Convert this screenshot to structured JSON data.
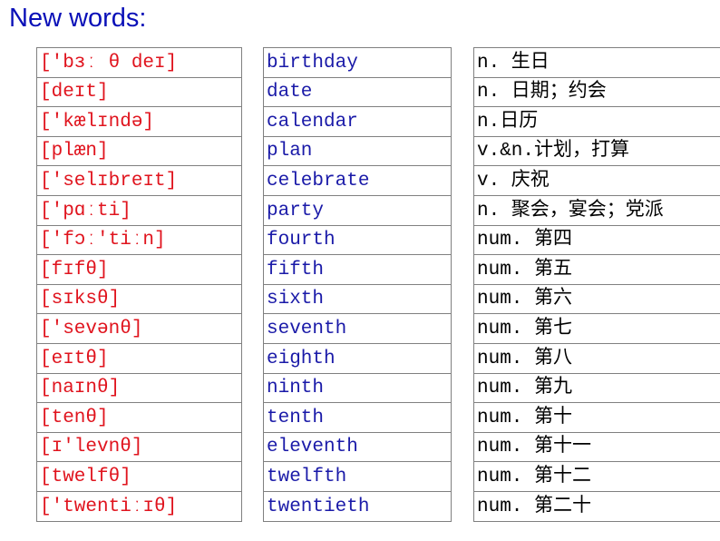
{
  "title": "New words:",
  "colors": {
    "title": "#0a10b8",
    "phonetic": "#e0141e",
    "word": "#1a1aa8",
    "meaning": "#000000"
  },
  "rows": [
    {
      "phonetic": "['bɜː θ deɪ]",
      "word": "birthday",
      "meaning": "n. 生日"
    },
    {
      "phonetic": "[deɪt]",
      "word": "date",
      "meaning": "n. 日期；约会"
    },
    {
      "phonetic": "['kælɪndə]",
      "word": "calendar",
      "meaning": "n.日历"
    },
    {
      "phonetic": "[plæn]",
      "word": "plan",
      "meaning": "v.&n.计划，打算"
    },
    {
      "phonetic": "['selɪbreɪt]",
      "word": "celebrate",
      "meaning": "v. 庆祝"
    },
    {
      "phonetic": "['pɑːti]",
      "word": "party",
      "meaning": "n. 聚会，宴会；党派"
    },
    {
      "phonetic": "['fɔː'tiːn]",
      "word": "fourth",
      "meaning": "num. 第四"
    },
    {
      "phonetic": "[fɪfθ]",
      "word": "fifth",
      "meaning": "num. 第五"
    },
    {
      "phonetic": "[sɪksθ]",
      "word": "sixth",
      "meaning": "num. 第六"
    },
    {
      "phonetic": "['sevənθ]",
      "word": "seventh",
      "meaning": "num. 第七"
    },
    {
      "phonetic": "[eɪtθ]",
      "word": "eighth",
      "meaning": "num. 第八"
    },
    {
      "phonetic": "[naɪnθ]",
      "word": "ninth",
      "meaning": "num. 第九"
    },
    {
      "phonetic": "[tenθ]",
      "word": "tenth",
      "meaning": "num. 第十"
    },
    {
      "phonetic": "[ɪ'levnθ]",
      "word": "eleventh",
      "meaning": "num. 第十一"
    },
    {
      "phonetic": "[twelfθ]",
      "word": "twelfth",
      "meaning": "num. 第十二"
    },
    {
      "phonetic": "['twentiːɪθ]",
      "word": "twentieth",
      "meaning": "num. 第二十"
    }
  ]
}
